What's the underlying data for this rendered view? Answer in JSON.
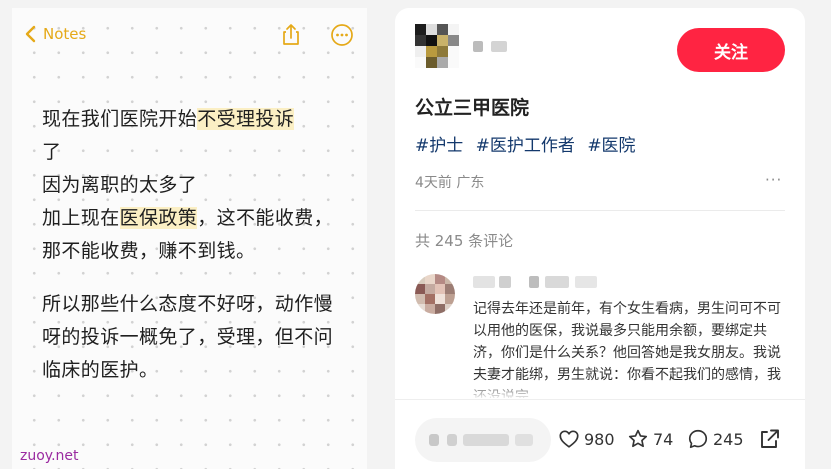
{
  "notes": {
    "back_label": "Notes",
    "paragraph1": [
      {
        "text": "现在我们医院开始",
        "hl": false
      },
      {
        "text": "不受理投诉",
        "hl": true
      },
      {
        "text": "了",
        "hl": false,
        "break_before": true
      },
      {
        "text": "因为离职的太多了",
        "hl": false,
        "break_before": true
      },
      {
        "text": "加上现在",
        "hl": false,
        "break_before": true
      },
      {
        "text": "医保政策",
        "hl": true
      },
      {
        "text": "，这不能收费，那不能收费，赚不到钱。",
        "hl": false
      }
    ],
    "paragraph2": "所以那些什么态度不好呀，动作慢呀的投诉一概免了，受理，但不问临床的医护。",
    "accent_color": "#e5a918",
    "highlight_color": "#fbefc4"
  },
  "watermark": "zuoy.net",
  "post": {
    "follow_label": "关注",
    "title": "公立三甲医院",
    "tags": [
      "#护士",
      "#医护工作者",
      "#医院"
    ],
    "meta": "4天前 广东",
    "comment_count": "共 245 条评论",
    "comment_text": "记得去年还是前年，有个女生看病，男生问可不可以用他的医保，我说最多只能用余额，要绑定共济，你们是什么关系？他回答她是我女朋友。我说夫妻才能绑，男生就说：你看不起我们的感情，我还没说完",
    "likes": "980",
    "stars": "74",
    "comments": "245",
    "follow_color": "#ff2442",
    "tag_color": "#13386c"
  }
}
